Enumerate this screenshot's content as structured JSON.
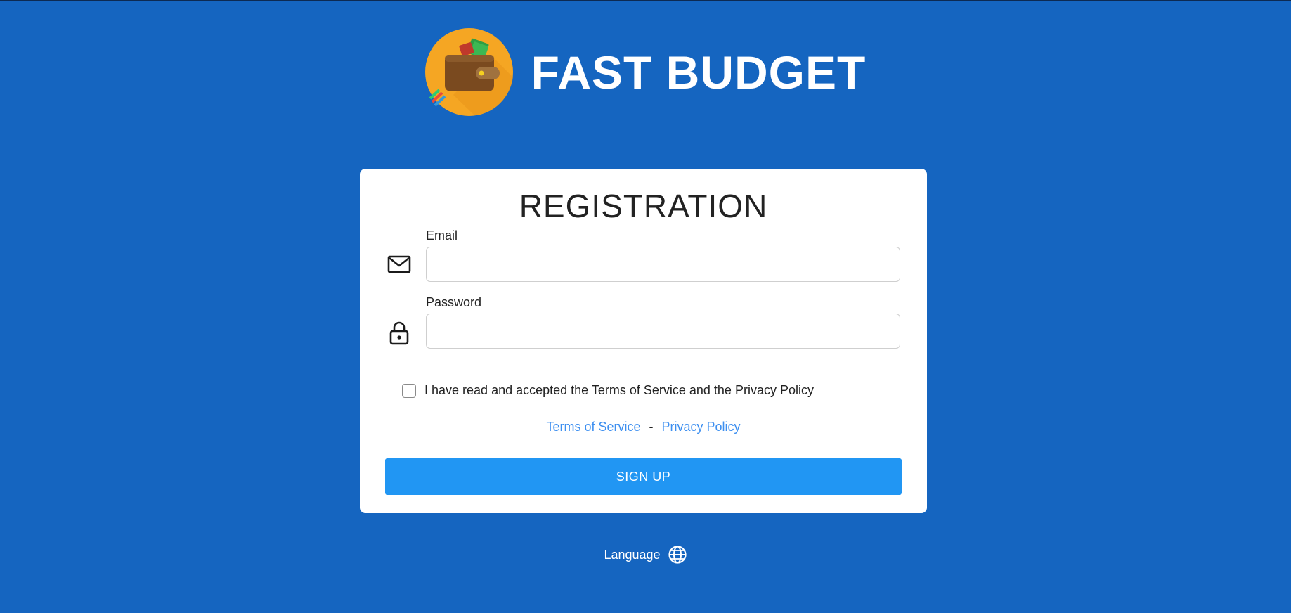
{
  "app": {
    "title": "FAST BUDGET",
    "logo_icon": "wallet-icon"
  },
  "form": {
    "heading": "REGISTRATION",
    "email": {
      "label": "Email",
      "value": "",
      "placeholder": "",
      "icon": "envelope-icon"
    },
    "password": {
      "label": "Password",
      "value": "",
      "placeholder": "",
      "icon": "lock-icon"
    },
    "terms_checkbox": {
      "label": "I have read and accepted the Terms of Service and the Privacy Policy",
      "checked": false
    },
    "links": {
      "terms": "Terms of Service",
      "separator": "-",
      "privacy": "Privacy Policy"
    },
    "submit_label": "SIGN UP"
  },
  "footer": {
    "language_label": "Language",
    "language_icon": "globe-icon"
  },
  "colors": {
    "background": "#1565C0",
    "card": "#FFFFFF",
    "button": "#2196F3",
    "link": "#3D8FF0",
    "logo_circle": "#F5A623",
    "wallet": "#7A4A1F"
  }
}
